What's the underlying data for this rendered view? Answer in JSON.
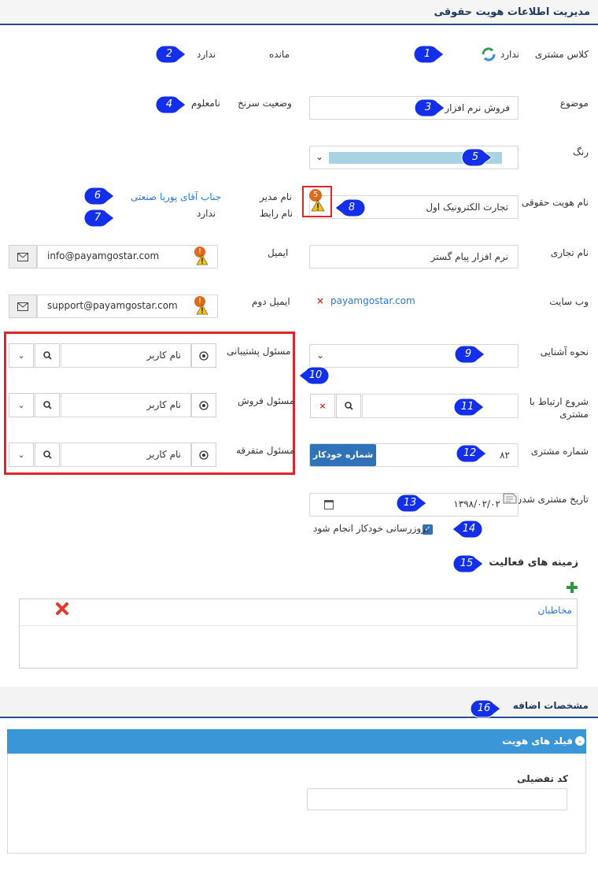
{
  "header": {
    "title": "مدیریت اطلاعات هویت حقوقی"
  },
  "markers": [
    "1",
    "2",
    "3",
    "4",
    "5",
    "6",
    "7",
    "8",
    "9",
    "10",
    "11",
    "12",
    "13",
    "14",
    "15",
    "16"
  ],
  "class": {
    "label": "کلاس مشتری",
    "value": "ندارد"
  },
  "balance": {
    "label": "مانده",
    "value": "ندارد"
  },
  "subject": {
    "label": "موضوع",
    "value": "فروش نرم افزار"
  },
  "rating": {
    "label": "وضعیت سرنخ",
    "value": "نامعلوم"
  },
  "color": {
    "label": "رنگ",
    "swatch": "#a9d3e2"
  },
  "identity_name": {
    "label": "نام هویت حقوقی",
    "value": "تجارت الکترونیک اول",
    "warning_count": "5"
  },
  "manager": {
    "label": "نام مدیر",
    "value": "جناب آقای پوریا صنعتی"
  },
  "liaison": {
    "label": "نام رابط",
    "value": "ندارد"
  },
  "trade_name": {
    "label": "نام تجاری",
    "value": "نرم افزار پیام گستر"
  },
  "email": {
    "label": "ایمیل",
    "value": "info@payamgostar.com"
  },
  "website": {
    "label": "وب سایت",
    "value": "payamgostar.com"
  },
  "email2": {
    "label": "ایمیل دوم",
    "value": "support@payamgostar.com"
  },
  "acquaintance": {
    "label": "نحوه آشنایی"
  },
  "support_owner": {
    "label": "مسئول پشتیبانی",
    "placeholder": "نام کاربر"
  },
  "sales_owner": {
    "label": "مسئول فروش",
    "placeholder": "نام کاربر"
  },
  "misc_owner": {
    "label": "مسئول متفرقه",
    "placeholder": "نام کاربر"
  },
  "start_contact": {
    "label": "شروع ارتباط با مشتری"
  },
  "customer_number": {
    "label": "شماره مشتری",
    "value": "۸۲",
    "auto_button": "شماره خودکار"
  },
  "customer_date": {
    "label": "تاریخ مشتری شدن",
    "value": "۱۳۹۸/۰۲/۰۲"
  },
  "auto_update": {
    "label": "بروزرسانی خودکار انجام شود",
    "checked": true
  },
  "activity": {
    "title": "زمینه های فعالیت",
    "items": [
      "مخاطبان"
    ]
  },
  "extra": {
    "tab": "مشخصات اضافه",
    "panel_title": "فیلد های هویت",
    "detail_code_label": "کد تفضیلی"
  },
  "colors": {
    "accent": "#3a96d6",
    "marker": "#1330e8",
    "header_line": "#1f4e8c",
    "red_box": "#e0262a"
  }
}
